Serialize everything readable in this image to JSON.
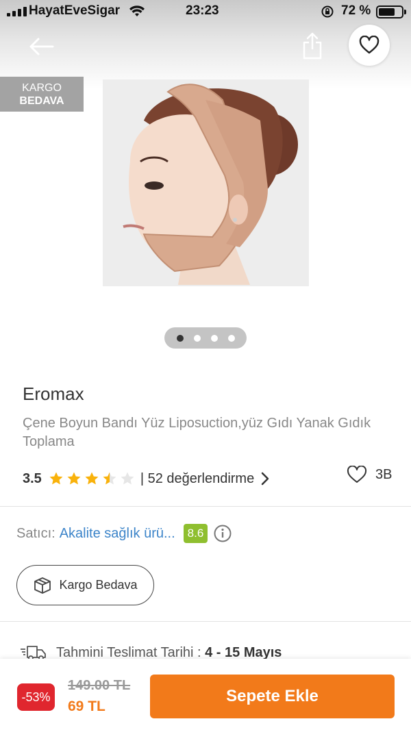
{
  "status_bar": {
    "carrier": "HayatEveSigar",
    "time": "23:23",
    "battery_percent": "72 %",
    "battery_level": 0.72
  },
  "nav": {
    "back_icon": "arrow-left-icon",
    "share_icon": "share-icon",
    "favorite_icon": "heart-outline-icon"
  },
  "badge": {
    "line1": "KARGO",
    "line2": "BEDAVA"
  },
  "gallery": {
    "page_count": 4,
    "active_index": 0
  },
  "product": {
    "brand": "Eromax",
    "name": "Çene Boyun Bandı Yüz Liposuction,yüz Gıdı Yanak Gıdık Toplama",
    "rating": "3.5",
    "rating_value": 3.5,
    "review_text": "| 52 değerlendirme",
    "like_count": "3B"
  },
  "seller": {
    "label": "Satıcı:",
    "name": "Akalite sağlık ürü...",
    "score": "8.6"
  },
  "shipping_chip": {
    "label": "Kargo Bedava"
  },
  "delivery": {
    "label": "Tahmini Teslimat Tarihi :",
    "range": "4 - 15 Mayıs"
  },
  "bottom_bar": {
    "discount": "-53%",
    "old_price": "149.00 TL",
    "new_price": "69 TL",
    "cta": "Sepete Ekle"
  },
  "colors": {
    "accent": "#f27a1a",
    "discount": "#e0262e",
    "seller_link": "#3c84c9",
    "seller_score": "#8fbf2f",
    "star": "#f9b20b"
  }
}
